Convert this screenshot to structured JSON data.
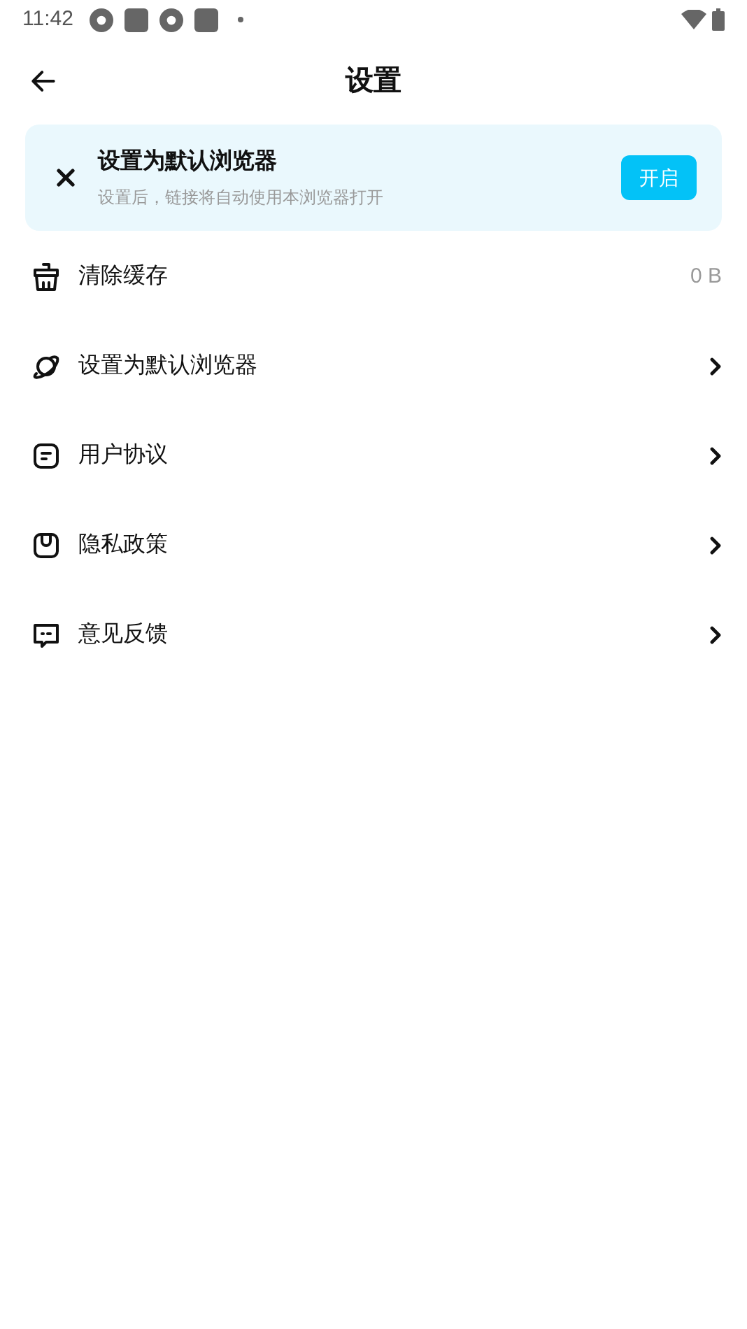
{
  "status_bar": {
    "time": "11:42"
  },
  "header": {
    "title": "设置"
  },
  "banner": {
    "title": "设置为默认浏览器",
    "subtitle": "设置后，链接将自动使用本浏览器打开",
    "button": "开启"
  },
  "items": [
    {
      "label": "清除缓存",
      "kind": "value",
      "value": "0 B"
    },
    {
      "label": "设置为默认浏览器",
      "kind": "link"
    },
    {
      "label": "用户协议",
      "kind": "link"
    },
    {
      "label": "隐私政策",
      "kind": "link"
    },
    {
      "label": "意见反馈",
      "kind": "link"
    }
  ]
}
